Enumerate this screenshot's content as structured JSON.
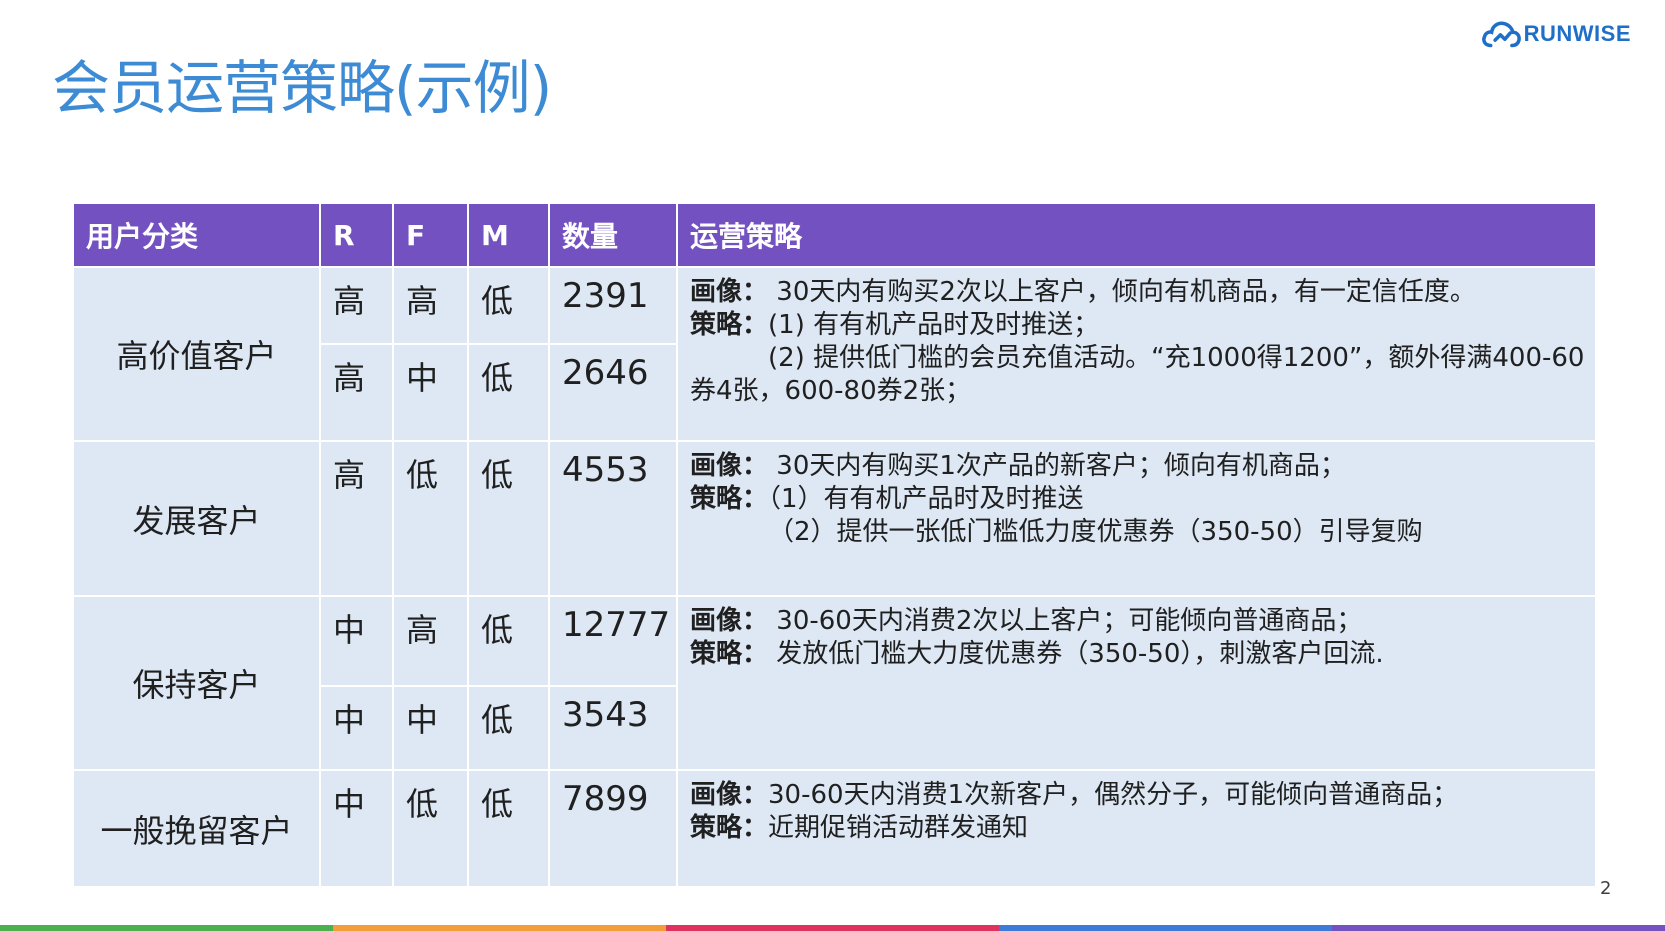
{
  "title": "会员运营策略(示例)",
  "logo": {
    "text": "RUNWISE",
    "icon": "cloud-logo-icon",
    "color": "#1f6fc9"
  },
  "colors": {
    "title": "#3d8bd4",
    "header_bg": "#7451c0",
    "cell_bg": "#dde8f4",
    "footer": [
      "#4caf50",
      "#f39c3a",
      "#e0325f",
      "#3d7bd8",
      "#7451c0"
    ]
  },
  "table": {
    "headers": {
      "segment": "用户分类",
      "r": "R",
      "f": "F",
      "m": "M",
      "count": "数量",
      "strategy": "运营策略"
    },
    "groups": [
      {
        "segment": "高价值客户",
        "rows": [
          {
            "r": "高",
            "f": "高",
            "m": "低",
            "count": "2391"
          },
          {
            "r": "高",
            "f": "中",
            "m": "低",
            "count": "2646"
          }
        ],
        "strategy": [
          {
            "label": "画像：",
            "text": " 30天内有购买2次以上客户，倾向有机商品，有一定信任度。"
          },
          {
            "label": "策略：",
            "text": "(1) 有有机产品时及时推送；"
          },
          {
            "label": "",
            "text": "(2) 提供低门槛的会员充值活动。“充1000得1200”，额外得满400-60券4张，600-80券2张；"
          }
        ]
      },
      {
        "segment": "发展客户",
        "rows": [
          {
            "r": "高",
            "f": "低",
            "m": "低",
            "count": "4553"
          }
        ],
        "strategy": [
          {
            "label": "画像：",
            "text": " 30天内有购买1次产品的新客户；倾向有机商品；"
          },
          {
            "label": "策略：",
            "text": "（1）有有机产品时及时推送"
          },
          {
            "label": "",
            "text": "（2）提供一张低门槛低力度优惠券（350-50）引导复购"
          }
        ]
      },
      {
        "segment": "保持客户",
        "rows": [
          {
            "r": "中",
            "f": "高",
            "m": "低",
            "count": "12777"
          },
          {
            "r": "中",
            "f": "中",
            "m": "低",
            "count": "3543"
          }
        ],
        "strategy": [
          {
            "label": "画像：",
            "text": " 30-60天内消费2次以上客户；可能倾向普通商品；"
          },
          {
            "label": "策略：",
            "text": " 发放低门槛大力度优惠券（350-50），刺激客户回流."
          }
        ]
      },
      {
        "segment": "一般挽留客户",
        "rows": [
          {
            "r": "中",
            "f": "低",
            "m": "低",
            "count": "7899"
          }
        ],
        "strategy": [
          {
            "label": "画像：",
            "text": "30-60天内消费1次新客户，偶然分子，可能倾向普通商品；"
          },
          {
            "label": "策略：",
            "text": "近期促销活动群发通知"
          }
        ]
      }
    ]
  },
  "page_number": "2"
}
